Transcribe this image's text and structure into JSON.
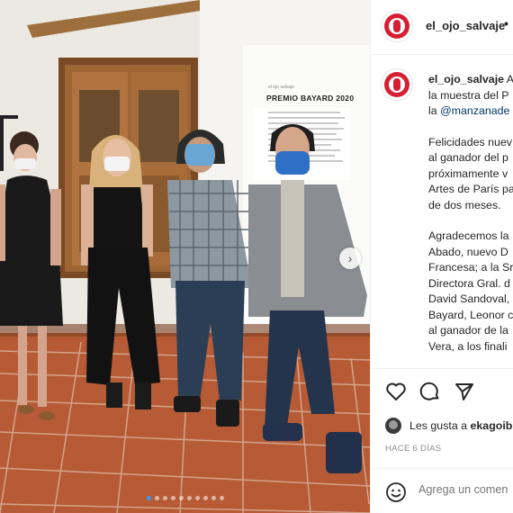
{
  "post": {
    "username": "el_ojo_salvaje",
    "header_separator": "•",
    "caption_lines": [
      {
        "user": "el_ojo_salvaje",
        "text": " A"
      },
      {
        "text": "la muestra del P"
      },
      {
        "prefix": "la ",
        "mention": "@manzanade"
      },
      {
        "gap": true
      },
      {
        "text": "Felicidades nuev"
      },
      {
        "text": "al ganador del p"
      },
      {
        "text": "próximamente v"
      },
      {
        "text": "Artes de París pa"
      },
      {
        "text": "de dos meses."
      },
      {
        "gap": true
      },
      {
        "text": "Agradecemos la"
      },
      {
        "text": "Abado, nuevo D"
      },
      {
        "text": "Francesa; a la Sra"
      },
      {
        "text": "Directora Gral. d"
      },
      {
        "text": "David Sandoval,"
      },
      {
        "text": "Bayard, Leonor c"
      },
      {
        "text": "al ganador de la"
      },
      {
        "text": "Vera,  a los finali"
      }
    ],
    "likes": {
      "prefix": "Les gusta a ",
      "user": "ekagoib"
    },
    "time_ago": "HACE 6 DÍAS",
    "comment_placeholder": "Agrega un comen"
  },
  "photo": {
    "poster_logo": "el ojo salvaje",
    "poster_title": "PREMIO BAYARD 2020",
    "carousel_count": 10,
    "carousel_active": 1
  },
  "icons": {
    "like": "heart-icon",
    "comment": "comment-icon",
    "share": "paper-plane-icon",
    "next": "chevron-right-icon",
    "emoji": "smiley-icon"
  },
  "colors": {
    "brand_red": "#d81e33",
    "carousel_active": "#3897f0",
    "mention": "#00376b",
    "muted": "#8e8e8e"
  }
}
